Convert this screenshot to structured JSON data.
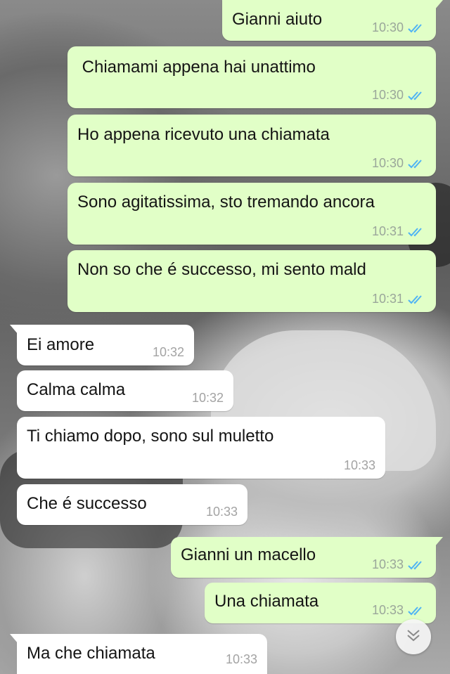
{
  "colors": {
    "outgoing_bubble": "#e1ffc7",
    "incoming_bubble": "#ffffff",
    "read_ticks": "#4fb3f4"
  },
  "messages": [
    {
      "direction": "out",
      "text": "Gianni aiuto",
      "time": "10:30",
      "status": "read"
    },
    {
      "direction": "out",
      "text": " Chiamami appena hai unattimo",
      "time": "10:30",
      "status": "read"
    },
    {
      "direction": "out",
      "text": "Ho appena ricevuto una chiamata",
      "time": "10:30",
      "status": "read"
    },
    {
      "direction": "out",
      "text": "Sono agitatissima, sto tremando ancora",
      "time": "10:31",
      "status": "read"
    },
    {
      "direction": "out",
      "text": "Non so che é successo, mi sento mald",
      "time": "10:31",
      "status": "read"
    },
    {
      "direction": "in",
      "text": "Ei amore",
      "time": "10:32"
    },
    {
      "direction": "in",
      "text": "Calma calma",
      "time": "10:32"
    },
    {
      "direction": "in",
      "text": "Ti chiamo dopo, sono sul muletto",
      "time": "10:33"
    },
    {
      "direction": "in",
      "text": "Che é successo",
      "time": "10:33"
    },
    {
      "direction": "out",
      "text": "Gianni un macello",
      "time": "10:33",
      "status": "read"
    },
    {
      "direction": "out",
      "text": "Una chiamata",
      "time": "10:33",
      "status": "read"
    },
    {
      "direction": "in",
      "text": "Ma che chiamata",
      "time": "10:33"
    }
  ],
  "icons": {
    "read_status": "double-check-icon",
    "scroll_down": "chevron-double-down-icon"
  }
}
